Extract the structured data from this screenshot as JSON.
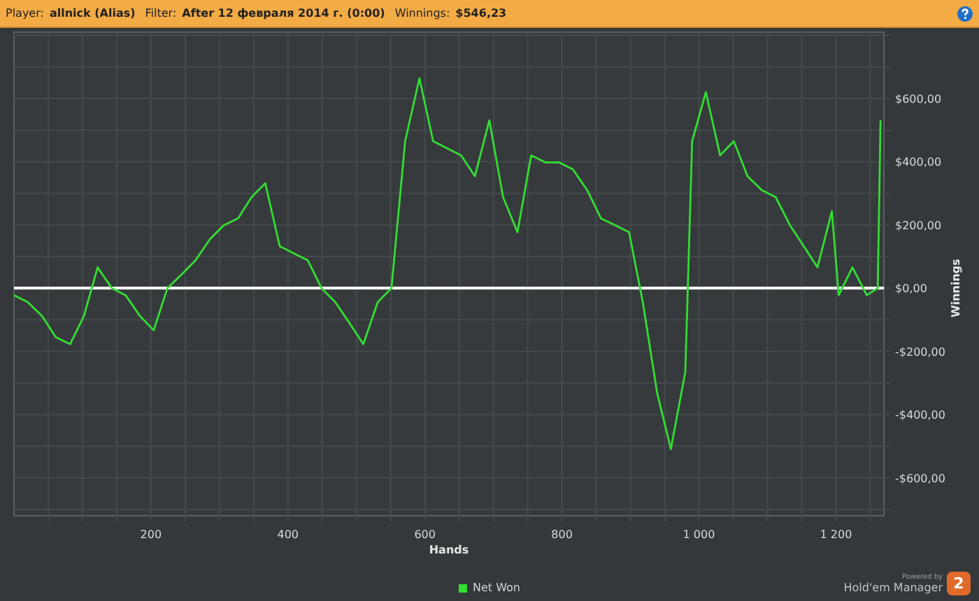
{
  "header": {
    "fields": [
      {
        "label": "Player:",
        "value": "allnick (Alias)"
      },
      {
        "label": "Filter:",
        "value": "After 12 февраля 2014 г. (0:00)"
      },
      {
        "label": "Winnings:",
        "value": "$546,23"
      }
    ]
  },
  "chart": {
    "chart_data": {
      "type": "line",
      "grid": true,
      "xlabel": "Hands",
      "ylabel": "Winnings",
      "xlim": [
        0,
        1270
      ],
      "ylim": [
        -720,
        810
      ],
      "xticks": [
        200,
        400,
        600,
        800,
        {
          "value": 1000,
          "label": "1 000"
        },
        {
          "value": 1200,
          "label": "1 200"
        }
      ],
      "yticks": [
        {
          "value": -600,
          "label": "-$600,00"
        },
        {
          "value": -400,
          "label": "-$400,00"
        },
        {
          "value": -200,
          "label": "-$200,00"
        },
        {
          "value": 0,
          "label": "$0,00"
        },
        {
          "value": 200,
          "label": "$200,00"
        },
        {
          "value": 400,
          "label": "$400,00"
        },
        {
          "value": 600,
          "label": "$600,00"
        }
      ],
      "x": [
        0,
        20,
        41,
        61,
        82,
        102,
        122,
        143,
        163,
        184,
        204,
        224,
        245,
        265,
        286,
        306,
        327,
        347,
        367,
        388,
        408,
        429,
        449,
        469,
        490,
        510,
        531,
        551,
        571,
        592,
        612,
        633,
        653,
        673,
        694,
        714,
        735,
        755,
        776,
        796,
        816,
        837,
        857,
        878,
        898,
        918,
        939,
        959,
        980,
        990,
        1010,
        1031,
        1051,
        1071,
        1092,
        1112,
        1133,
        1153,
        1173,
        1194,
        1204,
        1224,
        1245,
        1261,
        1265
      ],
      "series": [
        {
          "name": "Net Won",
          "color": "#33dd33",
          "values": [
            -22,
            -44,
            -88,
            -155,
            -177,
            -88,
            66,
            0,
            -22,
            -88,
            -133,
            0,
            44,
            88,
            155,
            199,
            221,
            288,
            332,
            133,
            111,
            88,
            0,
            -44,
            -111,
            -177,
            -44,
            0,
            465,
            664,
            465,
            442,
            420,
            354,
            531,
            288,
            177,
            420,
            398,
            398,
            376,
            310,
            221,
            199,
            177,
            -44,
            -332,
            -509,
            -265,
            465,
            620,
            420,
            465,
            354,
            310,
            288,
            199,
            133,
            66,
            243,
            -22,
            66,
            -22,
            0,
            531
          ]
        }
      ]
    }
  },
  "branding": {
    "caption": "Powered by",
    "product": "Hold'em Manager",
    "badge": "2"
  }
}
